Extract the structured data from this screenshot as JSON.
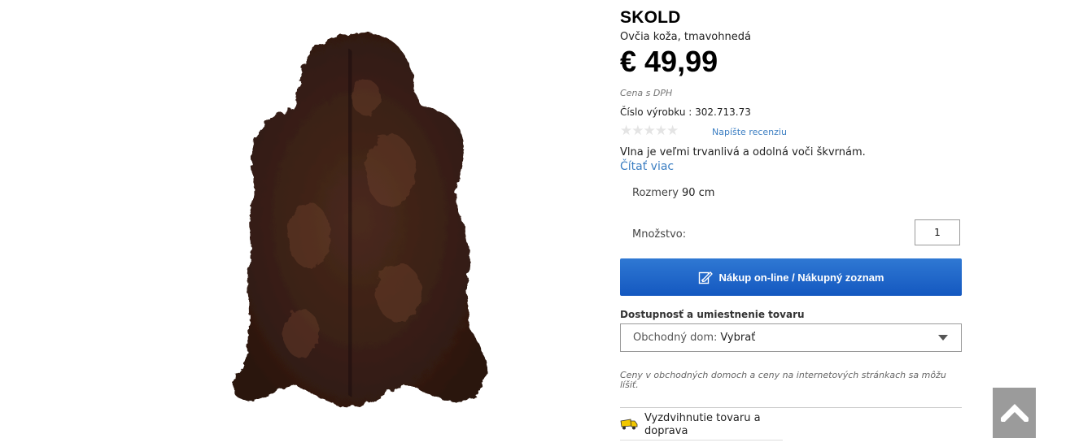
{
  "product": {
    "name": "SKOLD",
    "description": "Ovčia koža, tmavohnedá",
    "price": "€ 49,99",
    "vat_note": "Cena s DPH",
    "article_number": "Číslo výrobku : 302.713.73",
    "rating": {
      "stars_filled": 0,
      "stars_total": 5,
      "stars_glyph": "★★★★★"
    },
    "review_link": "Napíšte recenziu",
    "feature_text": "Vlna je veľmi trvanlivá a odolná voči škvrnám.",
    "read_more": "Čítať viac",
    "size_label": "Rozmery",
    "size_value": "90 cm",
    "quantity_label": "Množstvo:",
    "quantity_value": "1",
    "buy_button_label": "Nákup on-line / Nákupný zoznam",
    "buy_button_icon": "edit-list-icon",
    "availability_heading": "Dostupnosť a umiestnenie tovaru",
    "store_select_label": "Obchodný dom:",
    "store_select_value": "Vybrať",
    "price_note": "Ceny v obchodných domoch a ceny na internetových stránkach sa môžu líšiť.",
    "delivery_text": "Vyzdvihnutie tovaru a doprava",
    "delivery_icon": "truck-icon"
  },
  "image": {
    "subject": "product-image",
    "icon": "sheepskin-rug"
  },
  "scroll_top_icon": "chevron-up-icon",
  "colors": {
    "accent_blue": "#1e66c8",
    "link_blue": "#3b7ec2",
    "scroll_button": "#9b9b9b",
    "star_empty": "#e4e4e4",
    "fur": "#3a2016",
    "truck_yellow": "#f2c800"
  }
}
